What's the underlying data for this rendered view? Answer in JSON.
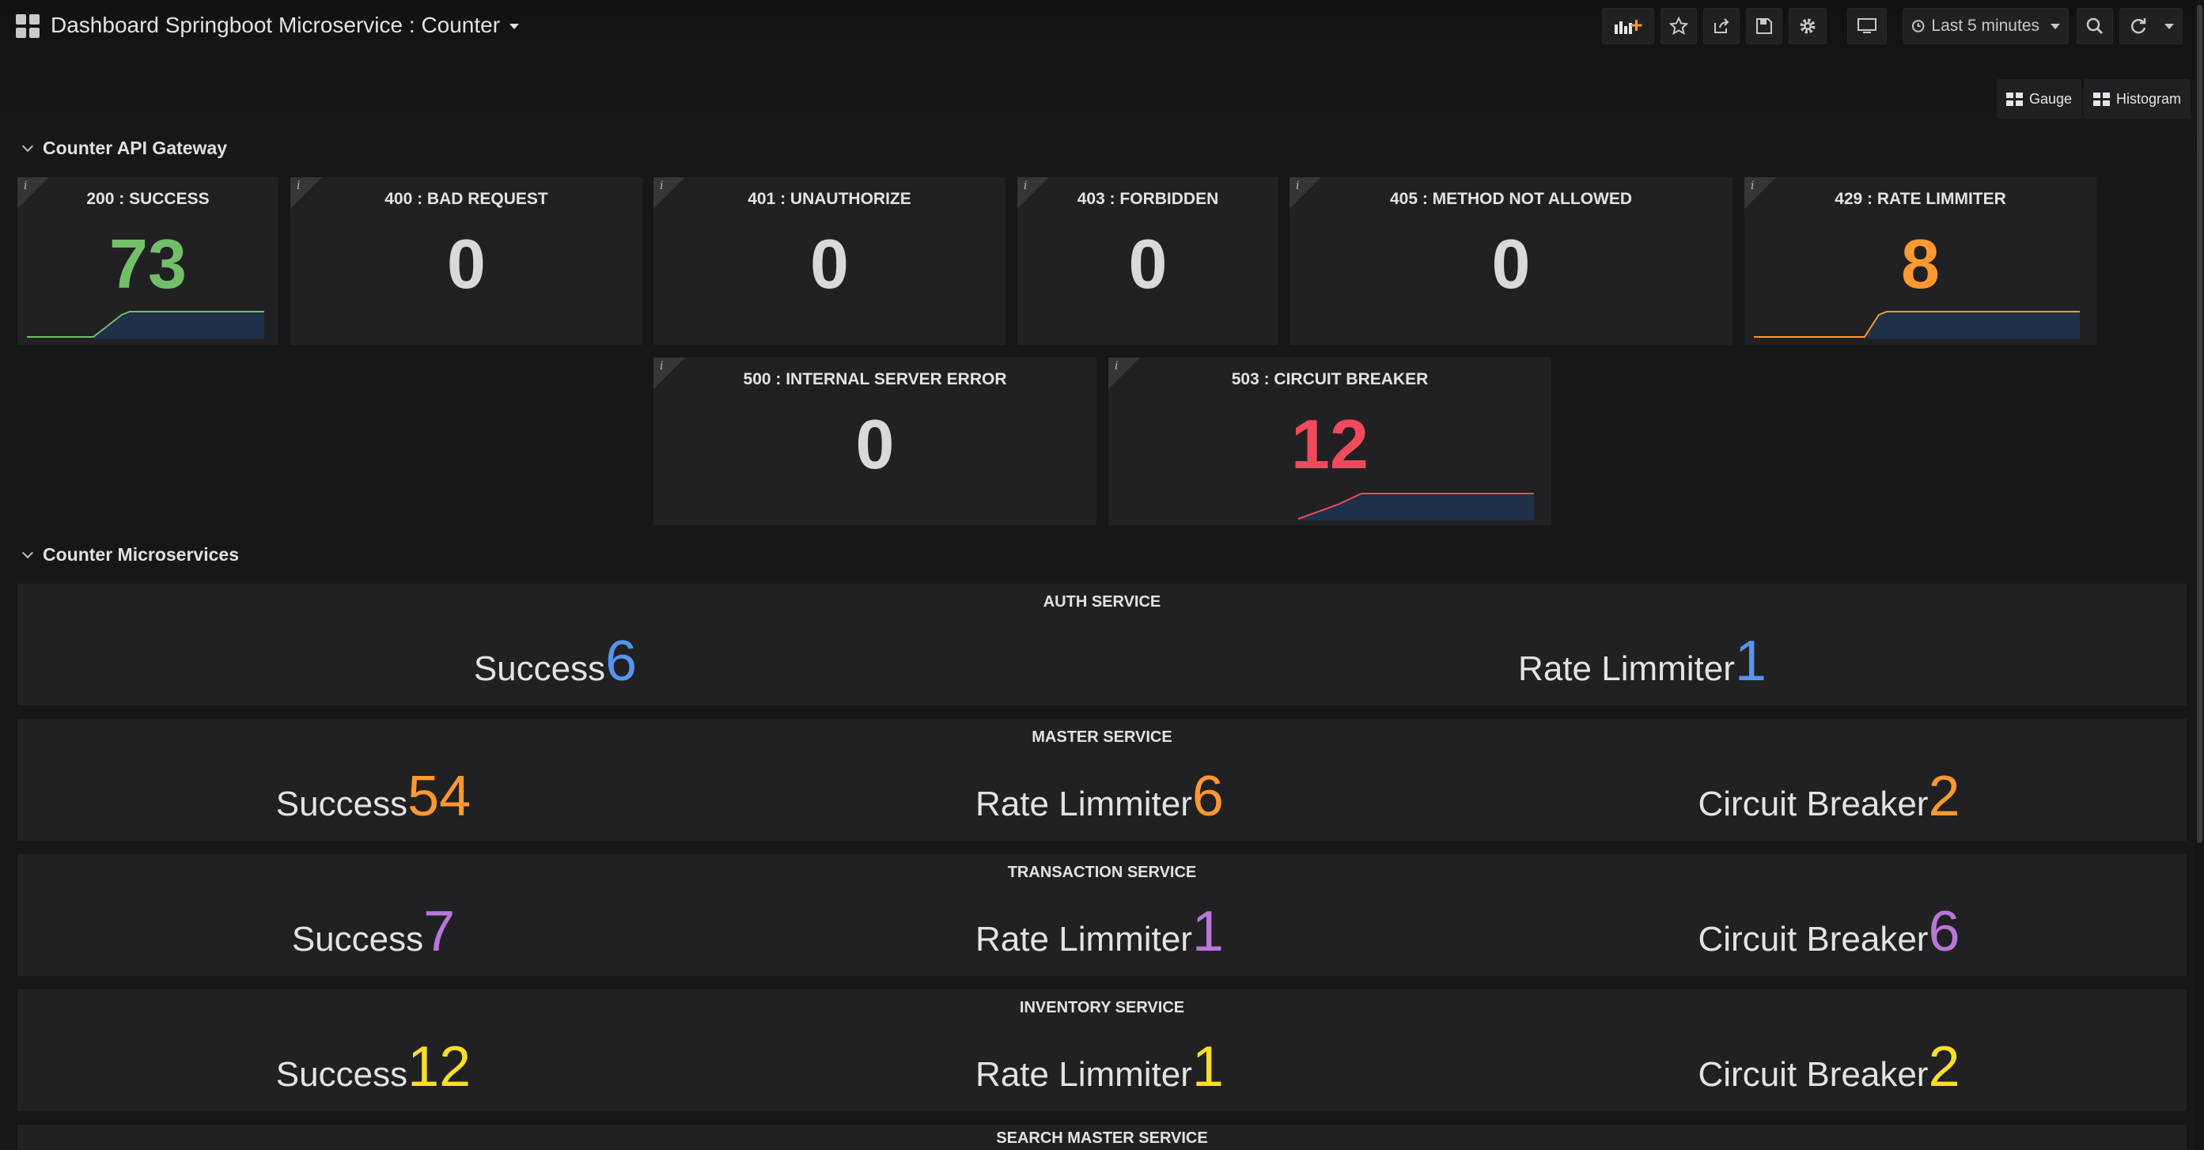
{
  "header": {
    "title": "Dashboard Springboot Microservice : Counter",
    "time_range": "Last 5 minutes"
  },
  "links": {
    "gauge": "Gauge",
    "histogram": "Histogram"
  },
  "rows": {
    "gateway_title": "Counter API Gateway",
    "microservices_title": "Counter Microservices"
  },
  "gateway_panels": [
    {
      "title": "200 : SUCCESS",
      "value": "73",
      "color": "#73bf69"
    },
    {
      "title": "400 : BAD REQUEST",
      "value": "0",
      "color": "#d8d9da"
    },
    {
      "title": "401 : UNAUTHORIZE",
      "value": "0",
      "color": "#d8d9da"
    },
    {
      "title": "403 : FORBIDDEN",
      "value": "0",
      "color": "#d8d9da"
    },
    {
      "title": "405 : METHOD NOT ALLOWED",
      "value": "0",
      "color": "#d8d9da"
    },
    {
      "title": "429 : RATE LIMMITER",
      "value": "8",
      "color": "#ff9830"
    },
    {
      "title": "500 : INTERNAL SERVER ERROR",
      "value": "0",
      "color": "#d8d9da"
    },
    {
      "title": "503 : CIRCUIT BREAKER",
      "value": "12",
      "color": "#f2495c"
    }
  ],
  "services": [
    {
      "title": "AUTH SERVICE",
      "color": "#5794f2",
      "stats": [
        {
          "label": "Success",
          "value": "6"
        },
        {
          "label": "Rate Limmiter",
          "value": "1"
        }
      ]
    },
    {
      "title": "MASTER SERVICE",
      "color": "#ff9830",
      "stats": [
        {
          "label": "Success",
          "value": "54"
        },
        {
          "label": "Rate Limmiter",
          "value": "6"
        },
        {
          "label": "Circuit Breaker",
          "value": "2"
        }
      ]
    },
    {
      "title": "TRANSACTION SERVICE",
      "color": "#b877d9",
      "stats": [
        {
          "label": "Success",
          "value": "7"
        },
        {
          "label": "Rate Limmiter",
          "value": "1"
        },
        {
          "label": "Circuit Breaker",
          "value": "6"
        }
      ]
    },
    {
      "title": "INVENTORY SERVICE",
      "color": "#fade2a",
      "stats": [
        {
          "label": "Success",
          "value": "12"
        },
        {
          "label": "Rate Limmiter",
          "value": "1"
        },
        {
          "label": "Circuit Breaker",
          "value": "2"
        }
      ]
    },
    {
      "title": "SEARCH MASTER SERVICE",
      "color": "#d8d9da",
      "stats": []
    }
  ],
  "icons": {
    "add_panel": "add-panel-icon",
    "star": "star-icon",
    "share": "share-icon",
    "save": "save-icon",
    "settings": "gear-icon",
    "tv": "tv-mode-icon",
    "clock": "clock-icon",
    "zoom": "zoom-out-icon",
    "refresh": "refresh-icon"
  }
}
